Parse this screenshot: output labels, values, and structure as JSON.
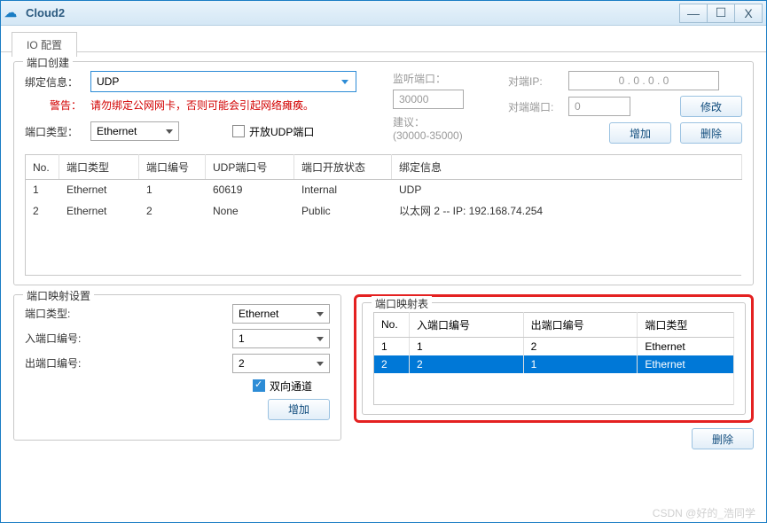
{
  "window": {
    "title": "Cloud2",
    "min": "—",
    "max": "☐",
    "close": "X"
  },
  "tabs": {
    "io": "IO 配置"
  },
  "portCreate": {
    "legend": "端口创建",
    "bindLabel": "绑定信息：",
    "bindValue": "UDP",
    "warnLabel": "警告：",
    "warnText": "请勿绑定公网网卡，否则可能会引起网络瘫痪。",
    "typeLabel": "端口类型：",
    "typeValue": "Ethernet",
    "openUdp": "开放UDP端口",
    "listenLabel": "监听端口：",
    "listenValue": "30000",
    "suggestLabel": "建议：",
    "suggestRange": "(30000-35000)",
    "peerIpLabel": "对端IP:",
    "peerIpValue": "0   .   0   .   0   .   0",
    "peerPortLabel": "对端端口:",
    "peerPortValue": "0",
    "modifyBtn": "修改",
    "addBtn": "增加",
    "delBtn": "删除",
    "headers": {
      "no": "No.",
      "type": "端口类型",
      "num": "端口编号",
      "udp": "UDP端口号",
      "state": "端口开放状态",
      "bind": "绑定信息"
    },
    "rows": [
      {
        "no": "1",
        "type": "Ethernet",
        "num": "1",
        "udp": "60619",
        "state": "Internal",
        "bind": "UDP"
      },
      {
        "no": "2",
        "type": "Ethernet",
        "num": "2",
        "udp": "None",
        "state": "Public",
        "bind": "以太网 2 -- IP: 192.168.74.254"
      }
    ]
  },
  "mapSettings": {
    "legend": "端口映射设置",
    "typeLabel": "端口类型:",
    "typeValue": "Ethernet",
    "inLabel": "入端口编号:",
    "inValue": "1",
    "outLabel": "出端口编号:",
    "outValue": "2",
    "bidir": "双向通道",
    "addBtn": "增加"
  },
  "mapTable": {
    "legend": "端口映射表",
    "headers": {
      "no": "No.",
      "in": "入端口编号",
      "out": "出端口编号",
      "type": "端口类型"
    },
    "rows": [
      {
        "no": "1",
        "in": "1",
        "out": "2",
        "type": "Ethernet",
        "selected": false
      },
      {
        "no": "2",
        "in": "2",
        "out": "1",
        "type": "Ethernet",
        "selected": true
      }
    ],
    "delBtn": "删除"
  },
  "watermark": "CSDN @好的_浩同学"
}
